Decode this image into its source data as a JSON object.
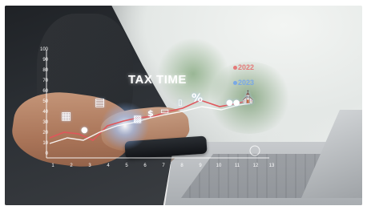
{
  "image": {
    "overlay_title": "TAX TIME",
    "years": [
      "2022",
      "2023"
    ],
    "y_ticks": [
      "100",
      "90",
      "80",
      "70",
      "60",
      "50",
      "40",
      "30",
      "20",
      "10",
      "0"
    ],
    "x_ticks": [
      "1",
      "2",
      "3",
      "4",
      "5",
      "6",
      "7",
      "8",
      "9",
      "10",
      "11",
      "12",
      "13"
    ],
    "symbols": {
      "percent": "%",
      "dollar": "$"
    },
    "icons": [
      "calculator-icon",
      "document-icon",
      "piggy-bank-icon",
      "chart-icon",
      "receipt-icon",
      "percent-icon",
      "people-icon",
      "bank-icon"
    ],
    "colors": {
      "line_red": "#e0565b",
      "line_white": "#ffffff",
      "glow_blue": "#7fb2ff"
    }
  }
}
